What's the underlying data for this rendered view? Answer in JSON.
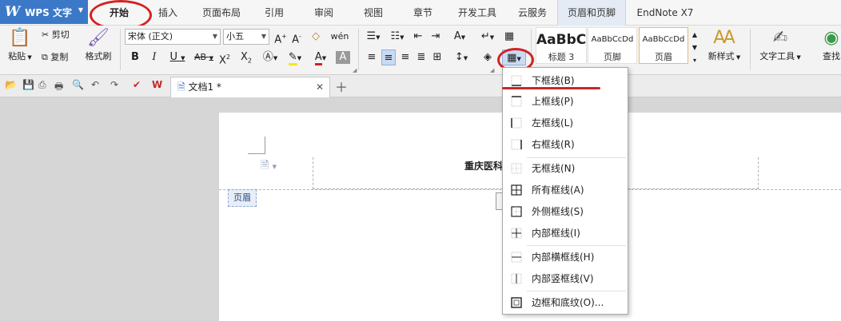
{
  "app": {
    "logo_text": "WPS 文字"
  },
  "menu_tabs": [
    {
      "label": "开始"
    },
    {
      "label": "插入"
    },
    {
      "label": "页面布局"
    },
    {
      "label": "引用"
    },
    {
      "label": "审阅"
    },
    {
      "label": "视图"
    },
    {
      "label": "章节"
    },
    {
      "label": "开发工具"
    },
    {
      "label": "云服务"
    },
    {
      "label": "页眉和页脚"
    },
    {
      "label": "EndNote X7"
    }
  ],
  "ribbon": {
    "paste": "粘贴",
    "cut": "剪切",
    "copy": "复制",
    "format_painter": "格式刷",
    "font_name": "宋体 (正文)",
    "font_size": "小五",
    "styles": [
      {
        "sample": "AaBbC",
        "label": "标题 3"
      },
      {
        "sample": "AaBbCcDd",
        "label": "页脚"
      },
      {
        "sample": "AaBbCcDd",
        "label": "页眉"
      }
    ],
    "new_style": "新样式",
    "text_tools": "文字工具",
    "find": "查找"
  },
  "document": {
    "tab_title": "文档1 *",
    "header_text": "重庆医科",
    "header_label": "页眉"
  },
  "border_menu": {
    "items": [
      {
        "label": "下框线(B)",
        "icon": "border-bottom-icon"
      },
      {
        "label": "上框线(P)",
        "icon": "border-top-icon"
      },
      {
        "label": "左框线(L)",
        "icon": "border-left-icon"
      },
      {
        "label": "右框线(R)",
        "icon": "border-right-icon"
      },
      {
        "label": "无框线(N)",
        "icon": "border-none-icon"
      },
      {
        "label": "所有框线(A)",
        "icon": "border-all-icon"
      },
      {
        "label": "外侧框线(S)",
        "icon": "border-outside-icon"
      },
      {
        "label": "内部框线(I)",
        "icon": "border-inside-icon"
      },
      {
        "label": "内部横框线(H)",
        "icon": "border-inside-horizontal-icon"
      },
      {
        "label": "内部竖框线(V)",
        "icon": "border-inside-vertical-icon"
      },
      {
        "label": "边框和底纹(O)...",
        "icon": "borders-and-shading-icon"
      }
    ]
  },
  "colors": {
    "logo_blue": "#3c78c8",
    "annotation_red": "#d42121",
    "header_tab_bg": "#e4ebf5",
    "font_color_red": "#d42121",
    "highlight_yellow": "#f5e90b"
  }
}
